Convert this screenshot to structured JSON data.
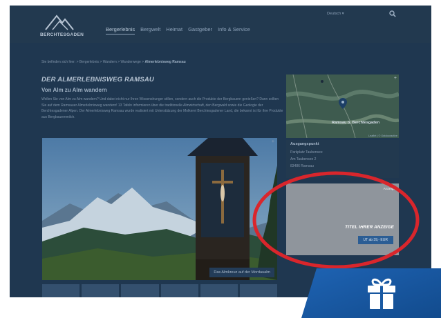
{
  "header": {
    "logo_text": "BERCHTESGADEN",
    "nav": [
      "Bergerlebnis",
      "Bergwelt",
      "Heimat",
      "Gastgeber",
      "Info & Service"
    ],
    "active_nav": "Bergerlebnis",
    "language": "Deutsch ▾"
  },
  "breadcrumb": {
    "prefix": "Sie befinden sich hier:",
    "items": [
      "Bergerlebnis",
      "Wandern",
      "Wanderwege"
    ],
    "current": "Almerlebnisweg Ramsau",
    "separator": " > "
  },
  "article": {
    "title": "DER ALMERLEBNISWEG RAMSAU",
    "subtitle": "Von Alm zu Alm wandern",
    "body": "Wollen Sie von Alm zu Alm wandern? Und dabei nicht nur Ihren Wissenshunger stillen, sondern auch die Produkte der Bergbauern genießen? Dann sollten Sie auf dem Ramsauer Almerlebnisweg wandern! 13 Tafeln informieren über die traditionelle Almwirtschaft, den Bergwald sowie die Geologie der Berchtesgadener Alpen. Der Almerlebnisweg Ramsau wurde realisiert mit Unterstützung der Molkerei Berchtesgadener Land, die bekannt ist für ihre Produkte aus Bergbauernmilch.",
    "photo_caption": "Das Almkreuz auf der Mordaualm",
    "thumbnail_count": 6
  },
  "sidebar": {
    "map_label": "Ramsau b. Berchtesgaden",
    "map_attribution": "Leaflet | © Outdooractive",
    "address_title": "Ausgangspunkt",
    "address_lines": [
      "Parkplatz Taubensee",
      "Am Taubensee 2",
      "83486 Ramsau"
    ]
  },
  "ad": {
    "label": "Anzeige",
    "title": "TITEL IHRER ANZEIGE",
    "button": "UT ab 39,- EUR"
  },
  "colors": {
    "overlay": "#1f3750",
    "highlight_oval": "#d9262c",
    "gift_band": "#1b5aa6"
  },
  "icons": [
    "logo-mountain-icon",
    "search-icon",
    "map-marker-icon",
    "expand-icon",
    "gift-icon"
  ]
}
